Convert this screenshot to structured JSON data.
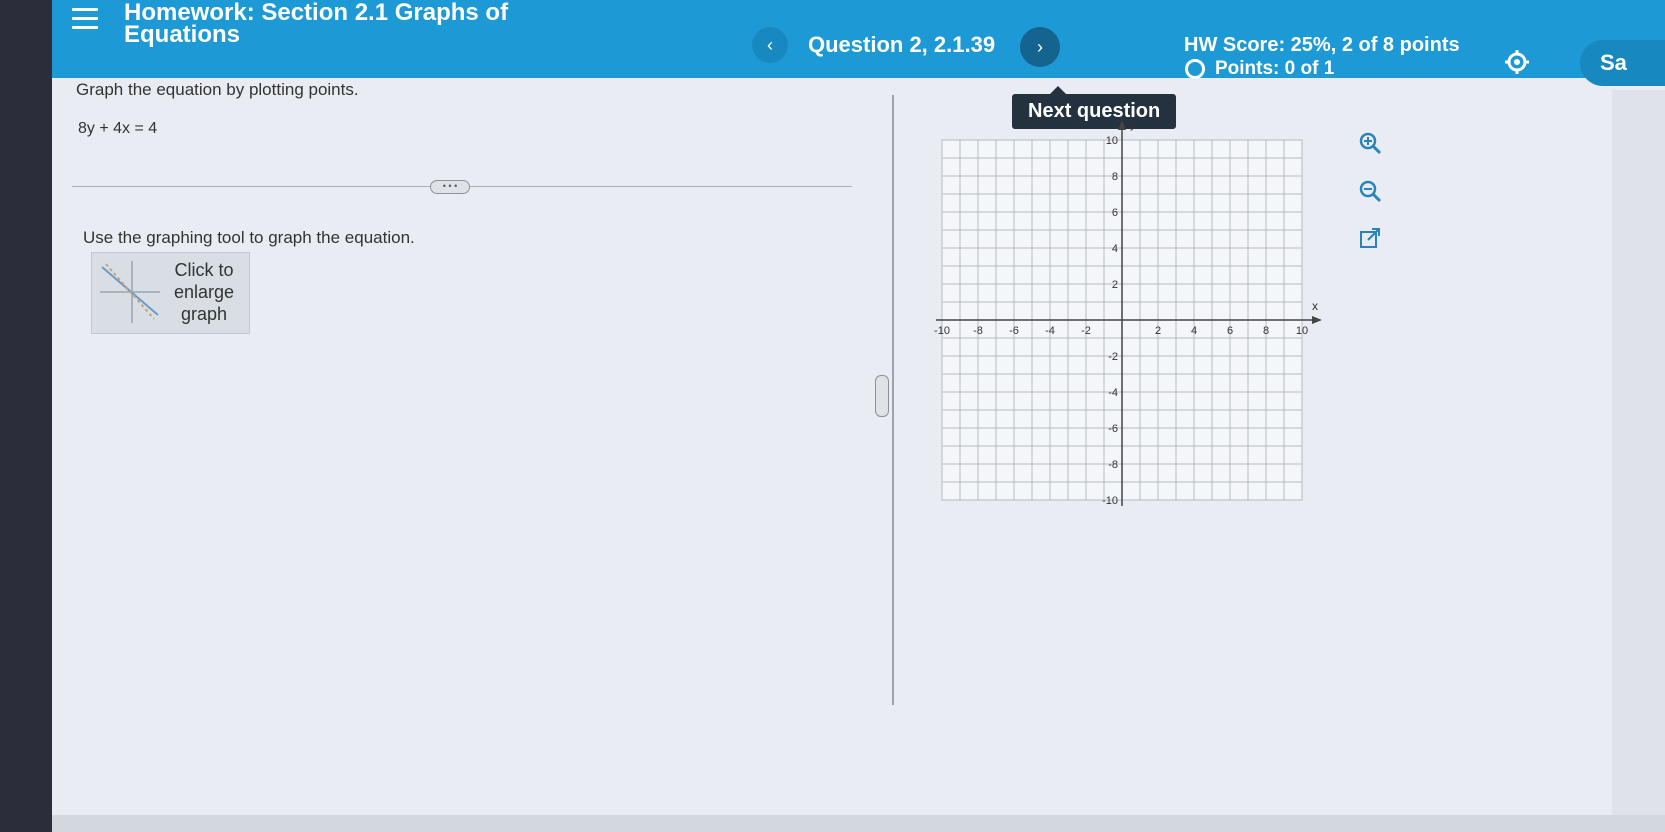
{
  "header": {
    "title": "Homework: Section 2.1 Graphs of Equations",
    "question_label": "Question 2, 2.1.39",
    "prev_icon": "chevron-left-icon",
    "next_icon": "chevron-right-icon",
    "next_tooltip": "Next question",
    "hw_score": "HW Score: 25%, 2 of 8 points",
    "points": "Points: 0 of 1",
    "settings_icon": "gear-icon",
    "save_label": "Sa"
  },
  "question": {
    "instruction": "Graph the equation by plotting points.",
    "equation": "8y + 4x = 4",
    "divider_handle": "• • •",
    "graph_instruction": "Use the graphing tool to graph the equation.",
    "enlarge_label": "Click to enlarge graph"
  },
  "graph": {
    "x_axis_label": "x",
    "y_axis_label": "y",
    "x_ticks": [
      "-10",
      "-8",
      "-6",
      "-4",
      "-2",
      "2",
      "4",
      "6",
      "8",
      "10"
    ],
    "y_ticks": [
      "10",
      "8",
      "6",
      "4",
      "2",
      "-2",
      "-4",
      "-6",
      "-8",
      "-10"
    ],
    "x_range": [
      -10,
      10
    ],
    "y_range": [
      -10,
      10
    ],
    "grid": true,
    "tools": [
      "zoom-in-icon",
      "zoom-out-icon",
      "external-link-icon"
    ]
  },
  "colors": {
    "header_bg": "#1d9ad6",
    "page_bg": "#e9edf3",
    "tooltip_bg": "#24323f"
  }
}
